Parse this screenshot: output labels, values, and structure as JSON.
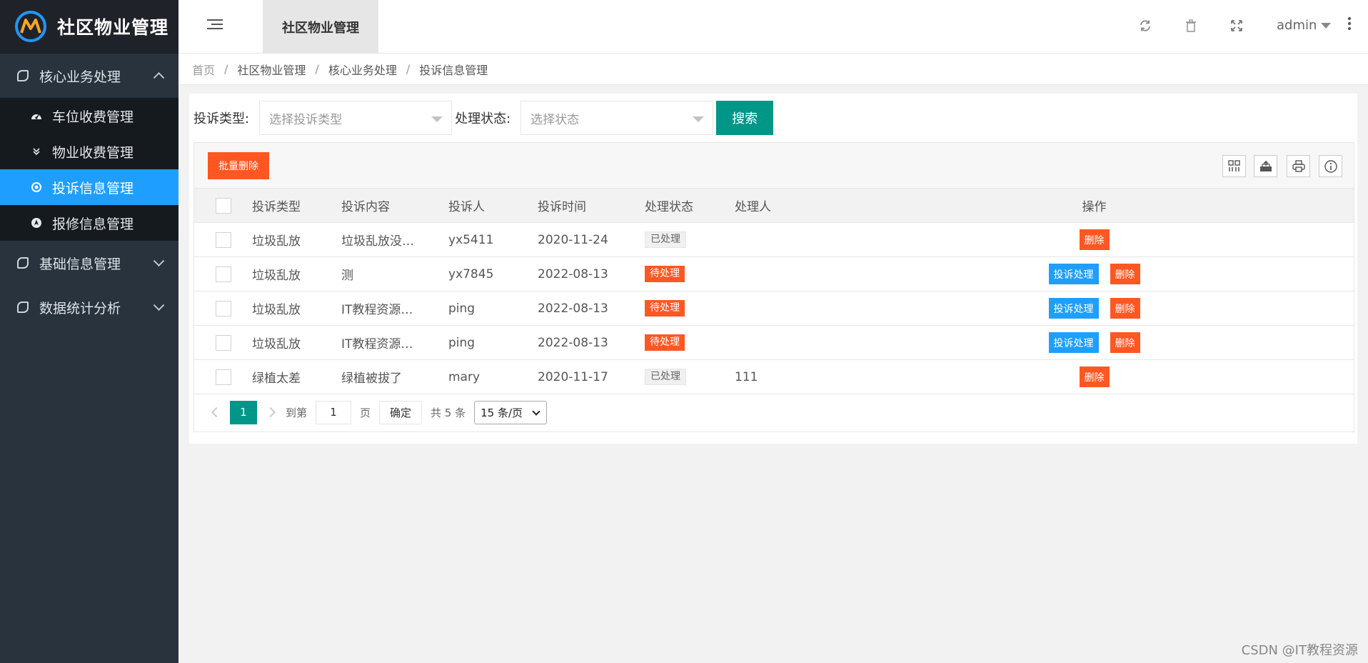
{
  "app": {
    "title": "社区物业管理"
  },
  "sidebar": {
    "groups": [
      {
        "label": "核心业务处理",
        "expanded": true
      },
      {
        "label": "基础信息管理",
        "expanded": false
      },
      {
        "label": "数据统计分析",
        "expanded": false
      }
    ],
    "items": [
      {
        "label": "车位收费管理",
        "icon": "dashboard-icon"
      },
      {
        "label": "物业收费管理",
        "icon": "double-chevron-down-icon"
      },
      {
        "label": "投诉信息管理",
        "icon": "target-icon",
        "active": true
      },
      {
        "label": "报修信息管理",
        "icon": "navigation-icon"
      }
    ]
  },
  "header": {
    "tab": "社区物业管理",
    "user": "admin"
  },
  "breadcrumb": [
    "首页",
    "社区物业管理",
    "核心业务处理",
    "投诉信息管理"
  ],
  "filter": {
    "type_label": "投诉类型:",
    "type_placeholder": "选择投诉类型",
    "status_label": "处理状态:",
    "status_placeholder": "选择状态",
    "search_button": "搜索"
  },
  "toolbar": {
    "batch_delete": "批量删除"
  },
  "table": {
    "columns": [
      "投诉类型",
      "投诉内容",
      "投诉人",
      "投诉时间",
      "处理状态",
      "处理人",
      "操作"
    ],
    "rows": [
      {
        "type": "垃圾乱放",
        "content": "垃圾乱放没…",
        "person": "yx5411",
        "time": "2020-11-24",
        "status": "已处理",
        "handler": ""
      },
      {
        "type": "垃圾乱放",
        "content": "测",
        "person": "yx7845",
        "time": "2022-08-13",
        "status": "待处理",
        "handler": ""
      },
      {
        "type": "垃圾乱放",
        "content": "IT教程资源…",
        "person": "ping",
        "time": "2022-08-13",
        "status": "待处理",
        "handler": ""
      },
      {
        "type": "垃圾乱放",
        "content": "IT教程资源…",
        "person": "ping",
        "time": "2022-08-13",
        "status": "待处理",
        "handler": ""
      },
      {
        "type": "绿植太差",
        "content": "绿植被拔了",
        "person": "mary",
        "time": "2020-11-17",
        "status": "已处理",
        "handler": "111"
      }
    ],
    "action_handle": "投诉处理",
    "action_delete": "删除"
  },
  "pager": {
    "current": "1",
    "goto_label": "到第",
    "goto_value": "1",
    "page_unit": "页",
    "confirm": "确定",
    "total": "共 5 条",
    "page_size": "15 条/页"
  },
  "watermark": "CSDN @IT教程资源",
  "colors": {
    "accent": "#009688",
    "danger": "#ff5722",
    "info": "#1e9fff",
    "sidebar": "#28333e"
  }
}
